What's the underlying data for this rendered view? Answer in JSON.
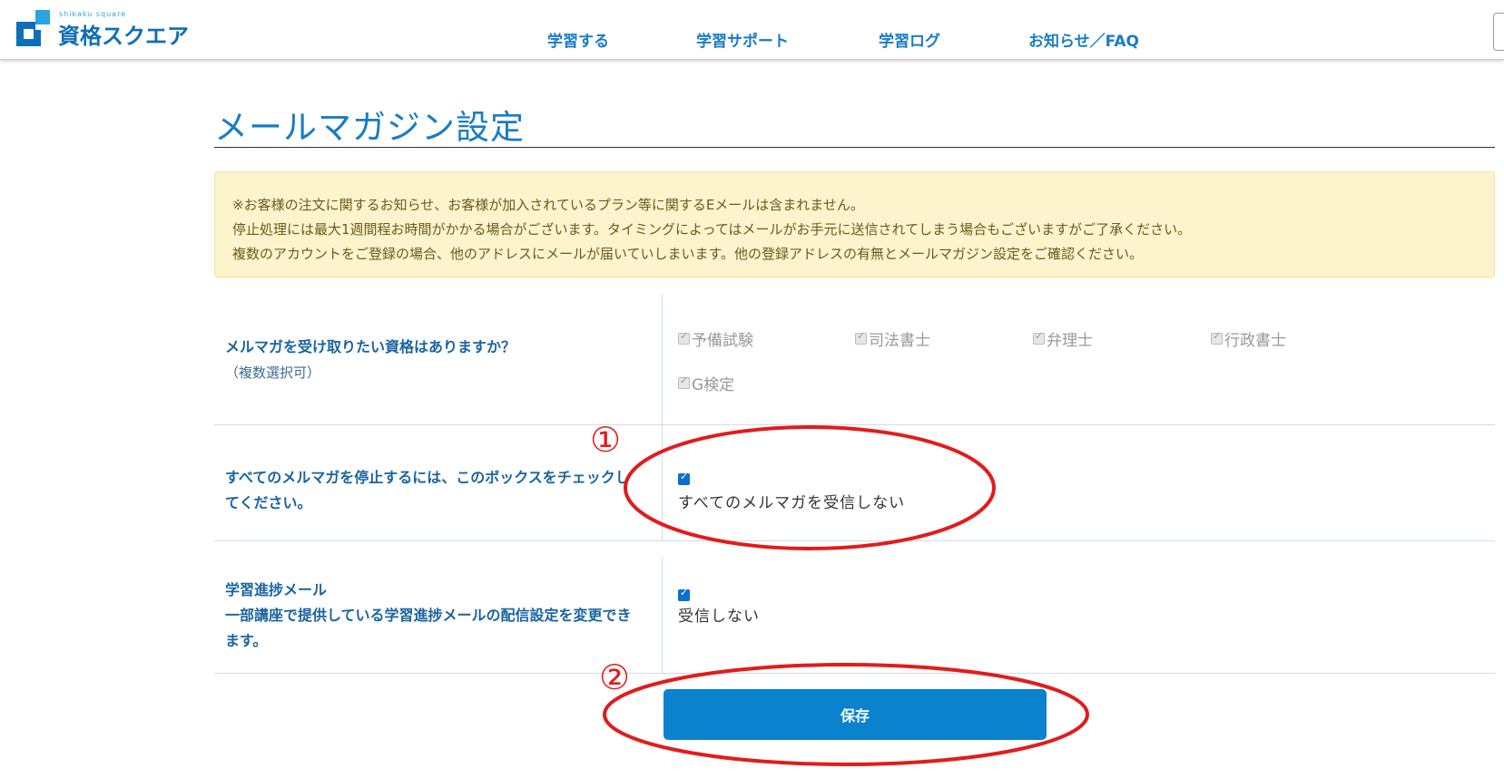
{
  "header": {
    "logo_sub": "shikaku square",
    "logo_text": "資格スクエア",
    "nav": [
      "学習する",
      "学習サポート",
      "学習ログ",
      "お知らせ／FAQ"
    ]
  },
  "page_title": "メールマガジン設定",
  "notice": {
    "lines": [
      "※お客様の注文に関するお知らせ、お客様が加入されているプラン等に関するEメールは含まれません。",
      "停止処理には最大1週間程お時間がかかる場合がございます。タイミングによってはメールがお手元に送信されてしまう場合もございますがご了承ください。",
      "複数のアカウントをご登録の場合、他のアドレスにメールが届いていしまいます。他の登録アドレスの有無とメールマガジン設定をご確認ください。"
    ]
  },
  "rows": {
    "qualifications": {
      "label": "メルマガを受け取りたい資格はありますか？",
      "sub": "（複数選択可）",
      "options": [
        "予備試験",
        "司法書士",
        "弁理士",
        "行政書士",
        "G検定"
      ]
    },
    "stop_all": {
      "label": "すべてのメルマガを停止するには、このボックスをチェックしてください。",
      "checkbox_label": "すべてのメルマガを受信しない",
      "checked": true
    },
    "progress": {
      "label": "学習進捗メール",
      "sub": "一部講座で提供している学習進捗メールの配信設定を変更できます。",
      "checkbox_label": "受信しない",
      "checked": true
    }
  },
  "save_label": "保存",
  "annotations": {
    "num1": "①",
    "num2": "②",
    "color": "#e31b1b"
  }
}
